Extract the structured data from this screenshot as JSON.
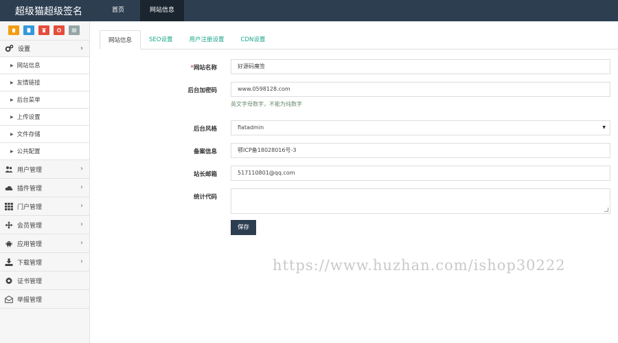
{
  "header": {
    "brand": "超级猫超级签名",
    "nav": [
      {
        "label": "首页",
        "active": false
      },
      {
        "label": "网站信息",
        "active": true
      }
    ]
  },
  "sidebar": {
    "quick_buttons": [
      {
        "icon": "home-icon",
        "color": "#f39c12"
      },
      {
        "icon": "document-icon",
        "color": "#3498db"
      },
      {
        "icon": "trash-icon",
        "color": "#e74c3c"
      },
      {
        "icon": "recycle-icon",
        "color": "#e74c3c"
      },
      {
        "icon": "list-icon",
        "color": "#95a5a6"
      }
    ],
    "settings": {
      "label": "设置",
      "icon": "gears-icon",
      "items": [
        "网站信息",
        "友情链接",
        "后台菜单",
        "上传设置",
        "文件存储",
        "公共配置"
      ]
    },
    "groups": [
      {
        "label": "用户管理",
        "icon": "users-icon",
        "chevron": true
      },
      {
        "label": "插件管理",
        "icon": "cloud-icon",
        "chevron": true
      },
      {
        "label": "门户管理",
        "icon": "grid-icon",
        "chevron": true
      },
      {
        "label": "会员管理",
        "icon": "move-icon",
        "chevron": true
      },
      {
        "label": "应用管理",
        "icon": "android-icon",
        "chevron": true
      },
      {
        "label": "下载管理",
        "icon": "download-icon",
        "chevron": true
      },
      {
        "label": "证书管理",
        "icon": "certificate-icon",
        "chevron": false
      },
      {
        "label": "举报管理",
        "icon": "envelope-icon",
        "chevron": false
      }
    ]
  },
  "tabs": [
    {
      "label": "网站信息",
      "active": true
    },
    {
      "label": "SEO设置",
      "active": false
    },
    {
      "label": "用户注册设置",
      "active": false
    },
    {
      "label": "CDN设置",
      "active": false
    }
  ],
  "form": {
    "site_name": {
      "required_mark": "*",
      "label": "网站名称",
      "value": "好源码魔签"
    },
    "icp": {
      "label": "后台加密码",
      "value": "www.0598128.com",
      "help": "英文字母数字，不能为纯数字"
    },
    "theme": {
      "label": "后台风格",
      "value": "flatadmin"
    },
    "beian": {
      "label": "备案信息",
      "value": "鄂ICP备18028016号-3"
    },
    "email": {
      "label": "站长邮箱",
      "value": "517110801@qq.com"
    },
    "stats": {
      "label": "统计代码",
      "value": ""
    },
    "save_label": "保存"
  },
  "watermark": "https://www.huzhan.com/ishop30222"
}
